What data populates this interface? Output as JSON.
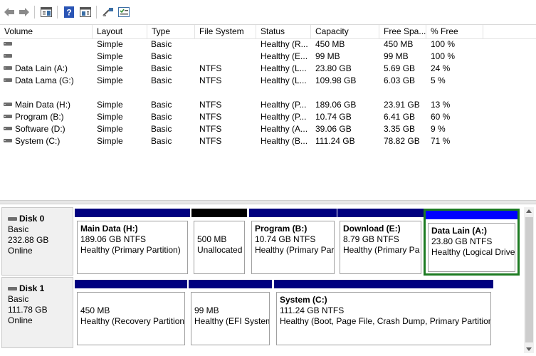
{
  "toolbar": {
    "icons": [
      "back-arrow-icon",
      "forward-arrow-icon",
      "console-tree-icon",
      "help-icon",
      "action-pane-icon",
      "connect-icon",
      "properties-icon"
    ]
  },
  "columns": [
    "Volume",
    "Layout",
    "Type",
    "File System",
    "Status",
    "Capacity",
    "Free Spa...",
    "% Free"
  ],
  "volumes": [
    {
      "volume": "",
      "layout": "Simple",
      "type": "Basic",
      "fs": "",
      "status": "Healthy (R...",
      "capacity": "450 MB",
      "free": "450 MB",
      "pct": "100 %"
    },
    {
      "volume": "",
      "layout": "Simple",
      "type": "Basic",
      "fs": "",
      "status": "Healthy (E...",
      "capacity": "99 MB",
      "free": "99 MB",
      "pct": "100 %"
    },
    {
      "volume": "Data Lain (A:)",
      "layout": "Simple",
      "type": "Basic",
      "fs": "NTFS",
      "status": "Healthy (L...",
      "capacity": "23.80 GB",
      "free": "5.69 GB",
      "pct": "24 %"
    },
    {
      "volume": "Data Lama (G:)",
      "layout": "Simple",
      "type": "Basic",
      "fs": "NTFS",
      "status": "Healthy (L...",
      "capacity": "109.98 GB",
      "free": "6.03 GB",
      "pct": "5 %"
    },
    {
      "volume": "",
      "layout": "",
      "type": "",
      "fs": "",
      "status": "",
      "capacity": "",
      "free": "",
      "pct": ""
    },
    {
      "volume": "Main Data (H:)",
      "layout": "Simple",
      "type": "Basic",
      "fs": "NTFS",
      "status": "Healthy (P...",
      "capacity": "189.06 GB",
      "free": "23.91 GB",
      "pct": "13 %"
    },
    {
      "volume": "Program (B:)",
      "layout": "Simple",
      "type": "Basic",
      "fs": "NTFS",
      "status": "Healthy (P...",
      "capacity": "10.74 GB",
      "free": "6.41 GB",
      "pct": "60 %"
    },
    {
      "volume": "Software (D:)",
      "layout": "Simple",
      "type": "Basic",
      "fs": "NTFS",
      "status": "Healthy (A...",
      "capacity": "39.06 GB",
      "free": "3.35 GB",
      "pct": "9 %"
    },
    {
      "volume": "System (C:)",
      "layout": "Simple",
      "type": "Basic",
      "fs": "NTFS",
      "status": "Healthy (B...",
      "capacity": "111.24 GB",
      "free": "78.82 GB",
      "pct": "71 %"
    }
  ],
  "disks": [
    {
      "name": "Disk 0",
      "kind": "Basic",
      "size": "232.88 GB",
      "state": "Online",
      "partitions": [
        {
          "name": "Main Data  (H:)",
          "size": "189.06 GB NTFS",
          "status": "Healthy (Primary Partition)",
          "bar": "#00007f"
        },
        {
          "name": "",
          "size": "500 MB",
          "status": "Unallocated",
          "bar": "#000000"
        },
        {
          "name": "Program  (B:)",
          "size": "10.74 GB NTFS",
          "status": "Healthy (Primary Par",
          "bar": "#00007f"
        },
        {
          "name": "Download  (E:)",
          "size": "8.79 GB NTFS",
          "status": "Healthy (Primary Pa",
          "bar": "#00007f"
        },
        {
          "name": "Data Lain  (A:)",
          "size": "23.80 GB NTFS",
          "status": "Healthy (Logical Drive",
          "bar": "#0000ff"
        }
      ]
    },
    {
      "name": "Disk 1",
      "kind": "Basic",
      "size": "111.78 GB",
      "state": "Online",
      "partitions": [
        {
          "name": "",
          "size": "450 MB",
          "status": "Healthy (Recovery Partition",
          "bar": "#00007f"
        },
        {
          "name": "",
          "size": "99 MB",
          "status": "Healthy (EFI System",
          "bar": "#00007f"
        },
        {
          "name": "System  (C:)",
          "size": "111.24 GB NTFS",
          "status": "Healthy (Boot, Page File, Crash Dump, Primary Partition",
          "bar": "#00007f"
        }
      ]
    }
  ],
  "colors": {
    "primary": "#00007f",
    "logical": "#0000ff",
    "unallocated": "#000000",
    "selection": "#1d7b22"
  }
}
